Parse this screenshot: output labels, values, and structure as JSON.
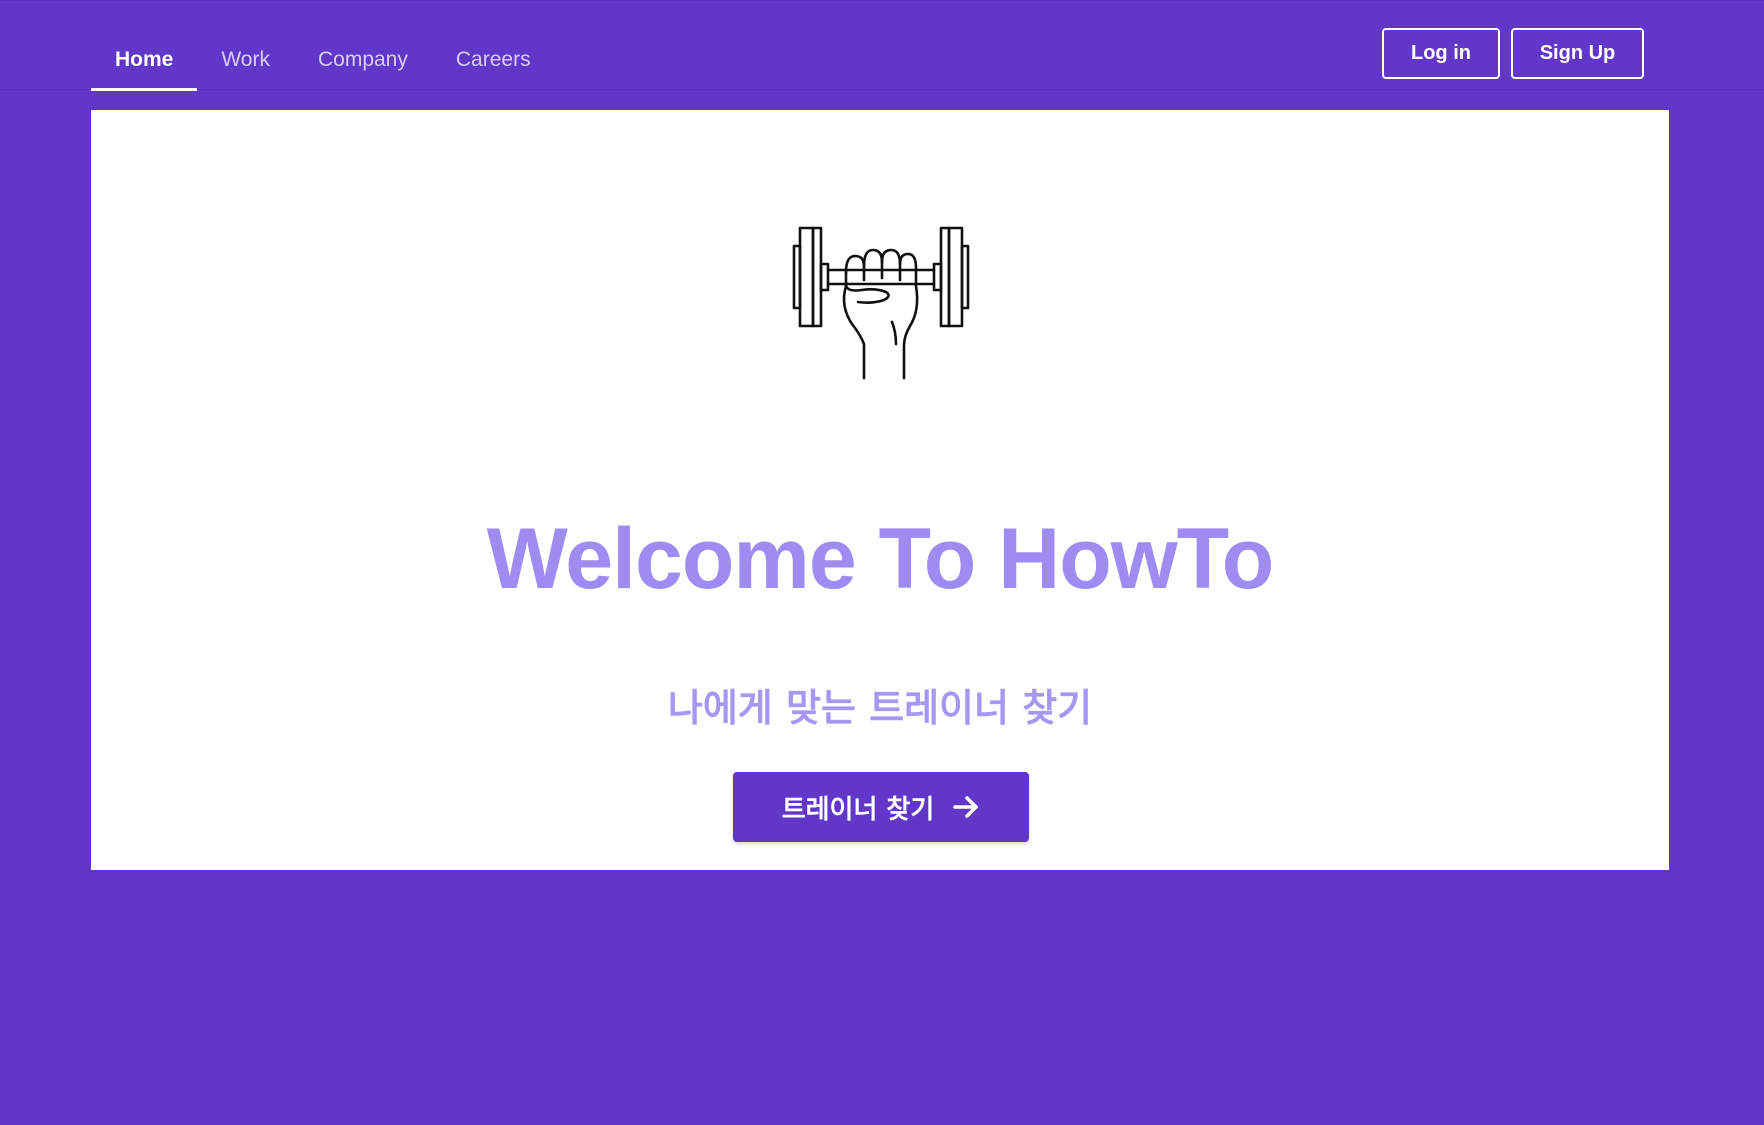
{
  "nav": {
    "tabs": [
      {
        "label": "Home",
        "active": true
      },
      {
        "label": "Work",
        "active": false
      },
      {
        "label": "Company",
        "active": false
      },
      {
        "label": "Careers",
        "active": false
      }
    ],
    "login_label": "Log in",
    "signup_label": "Sign Up"
  },
  "hero": {
    "icon": "dumbbell-fist-icon",
    "title": "Welcome To HowTo",
    "subtitle": "나에게 맞는 트레이너 찾기",
    "cta_label": "트레이너 찾기",
    "cta_icon": "arrow-right-icon"
  },
  "colors": {
    "background": "#6236c9",
    "accent_light": "#9f8cf3",
    "panel": "#ffffff"
  }
}
